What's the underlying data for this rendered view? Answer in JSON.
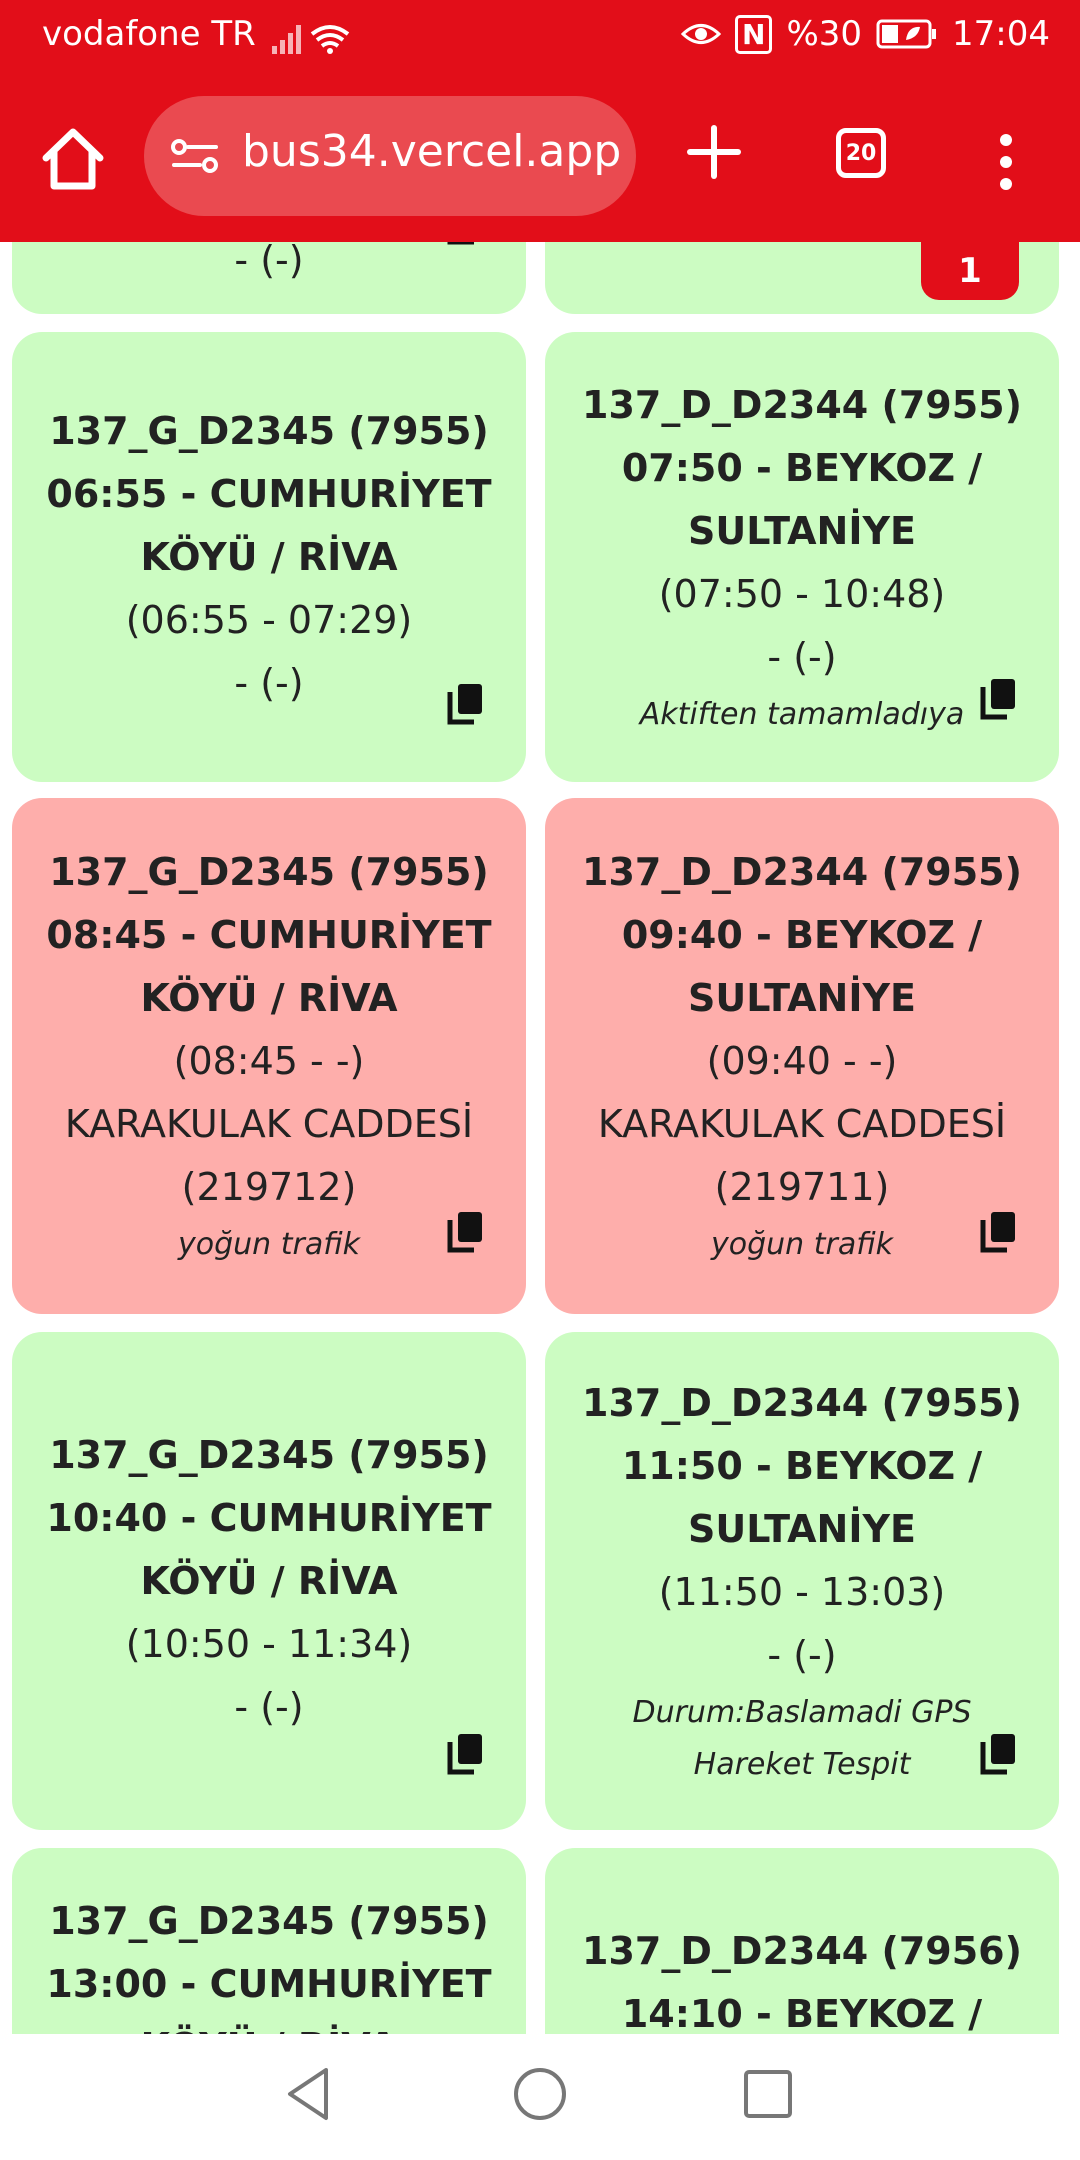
{
  "status_bar": {
    "carrier": "vodafone TR",
    "battery": "%30",
    "time": "17:04",
    "nfc": "N"
  },
  "browser": {
    "url": "bus34.vercel.app",
    "tab_count": "20"
  },
  "top_partial": {
    "left_text": "- (-)",
    "badge": "1"
  },
  "cards": [
    {
      "title": "137_G_D2345 (7955)",
      "line1": "06:55 - CUMHURİYET",
      "line2": "KÖYÜ / RİVA",
      "times": "(06:55 - 07:29)",
      "location": "- (-)",
      "note": ""
    },
    {
      "title": "137_D_D2344 (7955)",
      "line1": "07:50 - BEYKOZ /",
      "line2": "SULTANİYE",
      "times": "(07:50 - 10:48)",
      "location": "- (-)",
      "note": "Aktiften tamamladıya"
    },
    {
      "title": "137_G_D2345 (7955)",
      "line1": "08:45 - CUMHURİYET",
      "line2": "KÖYÜ / RİVA",
      "times": "(08:45 - -)",
      "location": "KARAKULAK CADDESİ",
      "location2": "(219712)",
      "note": "yoğun trafik"
    },
    {
      "title": "137_D_D2344 (7955)",
      "line1": "09:40 - BEYKOZ /",
      "line2": "SULTANİYE",
      "times": "(09:40 - -)",
      "location": "KARAKULAK CADDESİ",
      "location2": "(219711)",
      "note": "yoğun trafik"
    },
    {
      "title": "137_G_D2345 (7955)",
      "line1": "10:40 - CUMHURİYET",
      "line2": "KÖYÜ / RİVA",
      "times": "(10:50 - 11:34)",
      "location": "- (-)",
      "note": ""
    },
    {
      "title": "137_D_D2344 (7955)",
      "line1": "11:50 - BEYKOZ /",
      "line2": "SULTANİYE",
      "times": "(11:50 - 13:03)",
      "location": "- (-)",
      "note": "Durum:Baslamadi GPS Hareket Tespit"
    },
    {
      "title": "137_G_D2345 (7955)",
      "line1": "13:00 - CUMHURİYET",
      "line2": "KÖYÜ / RİVA"
    },
    {
      "title": "137_D_D2344 (7956)",
      "line1": "14:10 - BEYKOZ /"
    }
  ]
}
